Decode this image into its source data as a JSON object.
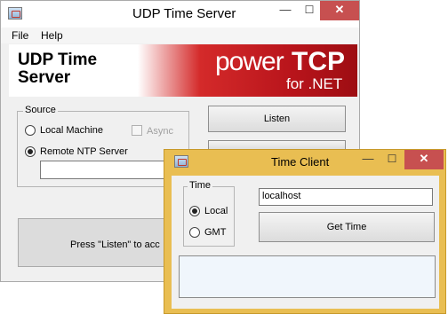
{
  "main_window": {
    "title": "UDP Time Server",
    "caption": {
      "minimize": "—",
      "maximize": "☐",
      "close": "✕"
    },
    "menu": {
      "file": "File",
      "help": "Help"
    },
    "banner": {
      "title": "UDP Time Server",
      "logo_power": "power",
      "logo_tcp": "TCP",
      "logo_net": "for .NET"
    },
    "source": {
      "label": "Source",
      "local_machine": "Local Machine",
      "async": "Async",
      "remote_ntp": "Remote NTP Server",
      "remote_ntp_value": "",
      "selected": "remote_ntp"
    },
    "listen_button": "Listen",
    "status": "Press \"Listen\" to acc"
  },
  "client_window": {
    "title": "Time Client",
    "caption": {
      "minimize": "—",
      "maximize": "☐",
      "close": "✕"
    },
    "time_group": {
      "label": "Time",
      "local": "Local",
      "gmt": "GMT",
      "selected": "local"
    },
    "host_value": "localhost",
    "get_time_button": "Get Time",
    "output": ""
  },
  "colors": {
    "client_frame": "#e9be52",
    "close_button": "#c75050",
    "banner_red": "#c4161d"
  },
  "icons": [
    "app-icon",
    "minimize-icon",
    "maximize-icon",
    "close-icon"
  ]
}
